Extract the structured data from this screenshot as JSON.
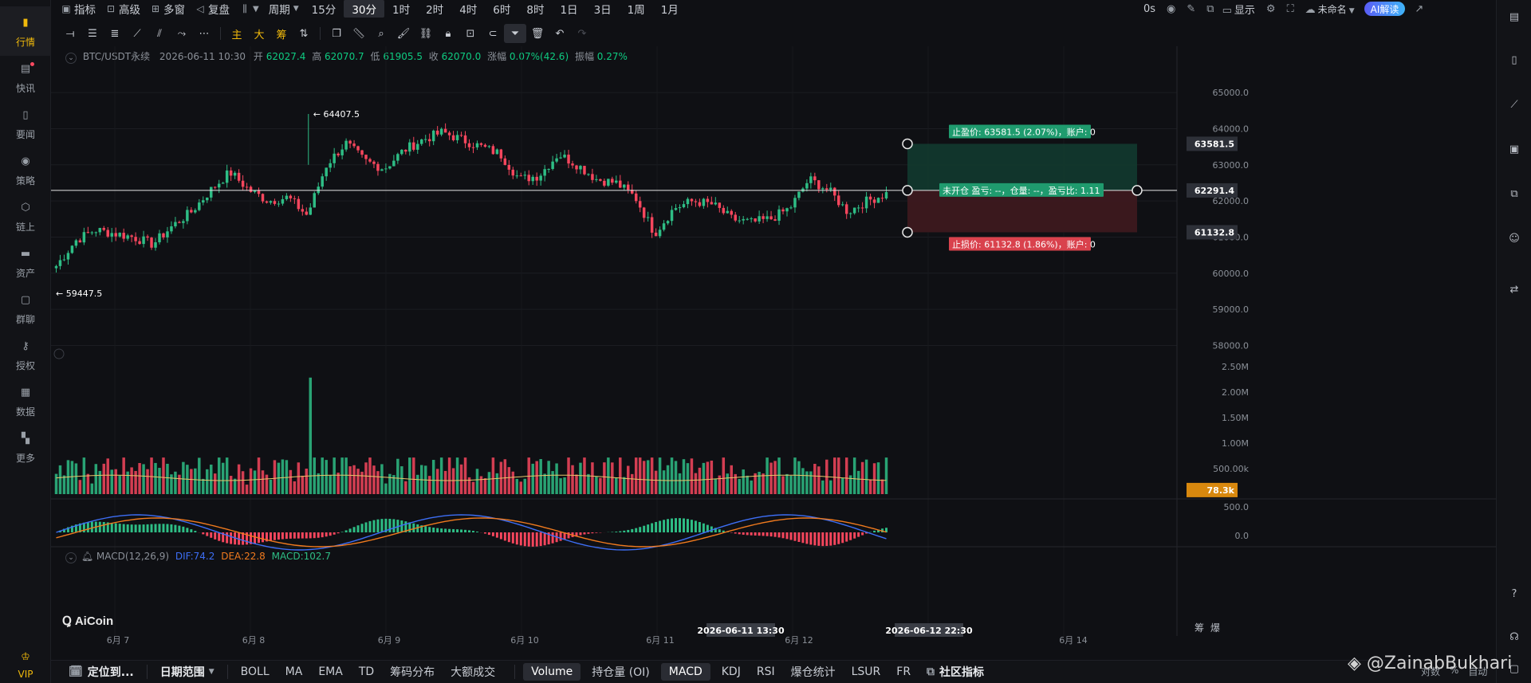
{
  "left_nav": [
    {
      "label": "行情",
      "icon": "bar-chart-icon",
      "active": true
    },
    {
      "label": "快讯",
      "icon": "news-icon",
      "badge": true
    },
    {
      "label": "要闻",
      "icon": "document-icon"
    },
    {
      "label": "策略",
      "icon": "robot-icon"
    },
    {
      "label": "链上",
      "icon": "onchain-icon"
    },
    {
      "label": "资产",
      "icon": "wallet-icon"
    },
    {
      "label": "群聊",
      "icon": "chat-icon"
    },
    {
      "label": "授权",
      "icon": "key-icon"
    },
    {
      "label": "数据",
      "icon": "data-board-icon"
    },
    {
      "label": "更多",
      "icon": "grid-more-icon"
    },
    {
      "label": "VIP",
      "icon": "vip-crown-icon"
    }
  ],
  "toolbar": {
    "indicators": "指标",
    "advanced": "高级",
    "multi_window": "多窗",
    "replay": "复盘",
    "period": "周期",
    "intervals": [
      "15分",
      "30分",
      "1时",
      "2时",
      "4时",
      "6时",
      "8时",
      "1日",
      "3日",
      "1周",
      "1月"
    ],
    "active_interval": "30分",
    "countdown": "0s",
    "display": "显示",
    "layout_name": "未命名",
    "ai_button": "AI解读"
  },
  "draw_tools": {
    "cjk_tools": [
      "主",
      "大",
      "筹"
    ]
  },
  "symbol_info": {
    "pair": "BTC/USDT永续",
    "datetime": "2026-06-11 10:30",
    "open_label": "开",
    "open": "62027.4",
    "high_label": "高",
    "high": "62070.7",
    "low_label": "低",
    "low": "61905.5",
    "close_label": "收",
    "close": "62070.0",
    "change_label": "涨幅",
    "change": "0.07%(42.6)",
    "amplitude_label": "振幅",
    "amplitude": "0.27%"
  },
  "macd_info": {
    "name": "MACD(12,26,9)",
    "dif": "DIF:74.2",
    "dea": "DEA:22.8",
    "macd": "MACD:102.7"
  },
  "logo_text": "AiCoin",
  "chart": {
    "price_ticks": [
      "65000.0",
      "64000.0",
      "63000.0",
      "62000.0",
      "61000.0",
      "60000.0",
      "59000.0",
      "58000.0"
    ],
    "volume_ticks": [
      "2.50M",
      "2.00M",
      "1.50M",
      "1.00M",
      "500.00k"
    ],
    "macd_ticks": [
      "500.0",
      "0.0"
    ],
    "date_labels": [
      "6月 7",
      "6月 8",
      "6月 9",
      "6月 10",
      "6月 11",
      "6月 12",
      "6月 14"
    ],
    "crosshair_start": "2026-06-11 13:30",
    "crosshair_end": "2026-06-12 22:30",
    "high_marker": "← 64407.5",
    "low_marker": "← 59447.5",
    "tp_tag": "63581.5",
    "entry_tag": "62291.4",
    "sl_tag": "61132.8",
    "volume_tag": "78.3k",
    "take_profit_label": "止盈价: 63581.5 (2.07%)，账户: 0",
    "open_position_label": "未开仓 盈亏: --，仓量: --，盈亏比: 1.11",
    "stop_loss_label": "止损价: 61132.8 (1.86%)，账户: 0",
    "right_labels": [
      "筹",
      "爆"
    ],
    "colors": {
      "up": "#2ebd85",
      "down": "#f6465d",
      "tp_zone": "#123a2f",
      "sl_zone": "#3f1a1e"
    }
  },
  "chart_data": {
    "type": "candlestick",
    "symbol": "BTC/USDT永续",
    "interval": "30分",
    "ylim": [
      57900,
      65400
    ],
    "period_high": 64407.5,
    "period_low": 59447.5,
    "close_path": [
      60200,
      60900,
      61200,
      61100,
      61000,
      60800,
      61300,
      61700,
      62300,
      62800,
      62300,
      62000,
      62100,
      61600,
      63000,
      63600,
      63100,
      62900,
      63400,
      63700,
      63900,
      63700,
      63500,
      63300,
      62600,
      62700,
      63300,
      63000,
      62600,
      62500,
      62100,
      61100,
      61800,
      62000,
      61900,
      61500,
      61400,
      61500,
      61800,
      62600,
      62300,
      61700,
      62000,
      62200
    ]
  },
  "bottom_bar": {
    "locate": "定位到...",
    "date_range": "日期范围",
    "main_indicators": [
      "BOLL",
      "MA",
      "EMA",
      "TD",
      "筹码分布",
      "大额成交"
    ],
    "sub_indicators": [
      "Volume",
      "持仓量 (OI)",
      "MACD",
      "KDJ",
      "RSI",
      "爆仓统计",
      "LSUR",
      "FR"
    ],
    "active_sub": [
      "Volume",
      "MACD"
    ],
    "community": "社区指标",
    "right_small": [
      "对数",
      "%",
      "自动"
    ]
  },
  "watermark": "@ZainabBukhari"
}
